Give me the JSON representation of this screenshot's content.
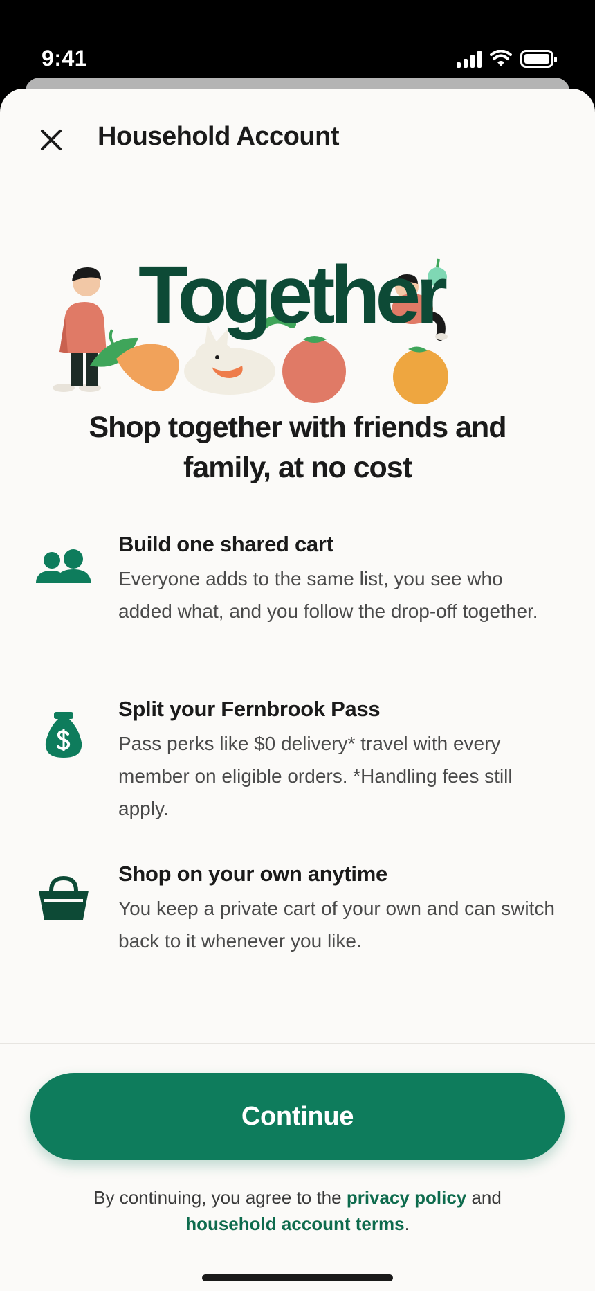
{
  "status_bar": {
    "time": "9:41"
  },
  "header": {
    "title": "Household Account"
  },
  "hero": {
    "word": "Together"
  },
  "headline": "Shop together with friends and family, at no cost",
  "features": [
    {
      "icon": "people-icon",
      "title": "Build one shared cart",
      "body": "Everyone adds to the same list, you see who added what, and you follow the drop-off together."
    },
    {
      "icon": "money-bag-icon",
      "title": "Split your Fernbrook Pass",
      "body": "Pass perks like $0 delivery* travel with every member on eligible orders. *Handling fees still apply."
    },
    {
      "icon": "basket-icon",
      "title": "Shop on your own anytime",
      "body": "You keep a private cart of your own and can switch back to it whenever you like."
    }
  ],
  "continue_label": "Continue",
  "legal": {
    "prefix": "By continuing, you agree to the ",
    "privacy_link": "privacy policy",
    "middle": " and",
    "terms_link": "household account terms",
    "suffix": "."
  },
  "colors": {
    "accent": "#0e7c5c",
    "dark_green": "#0d4a36",
    "background": "#fbfaf8"
  }
}
